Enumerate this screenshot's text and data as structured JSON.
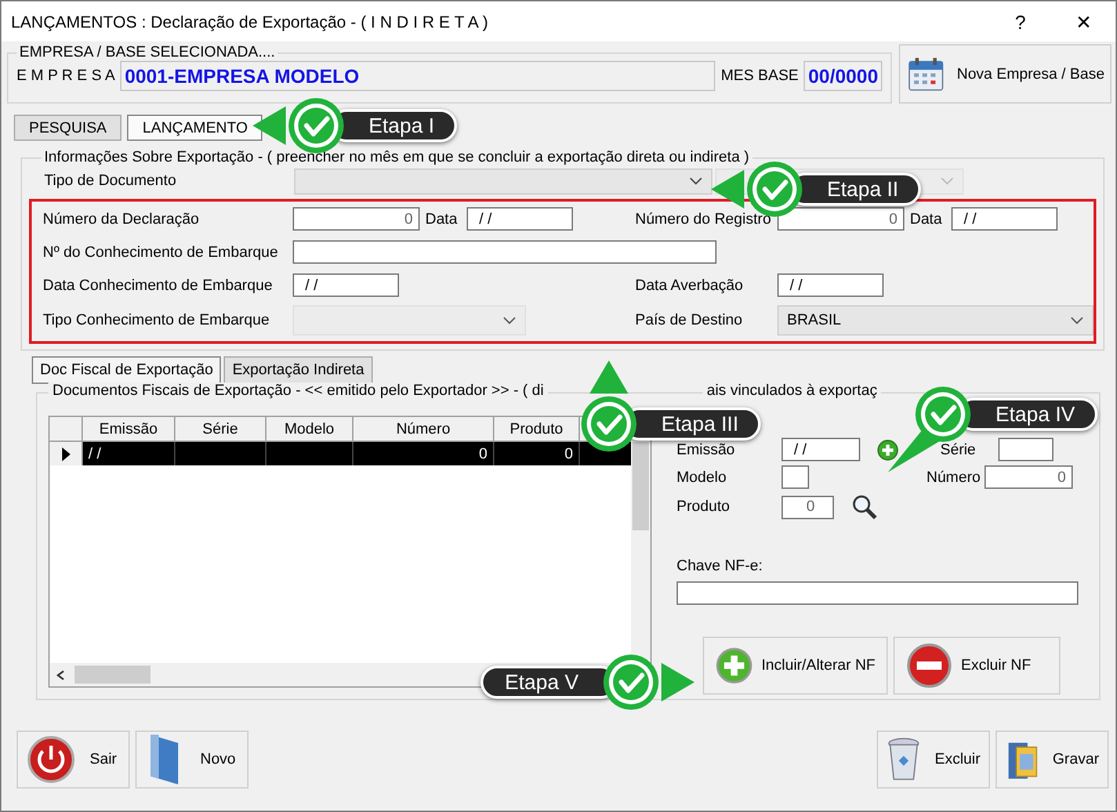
{
  "window": {
    "title": "LANÇAMENTOS : Declaração de Exportação - ( I N D I R E T A )",
    "buttons": [
      "?",
      "✕"
    ]
  },
  "empresa": {
    "legend": "EMPRESA / BASE SELECIONADA....",
    "label": "E M P R E S A",
    "value": "0001-EMPRESA MODELO",
    "mes_label": "MES BASE",
    "mes_value": "00/0000",
    "button": "Nova Empresa / Base"
  },
  "tabs": [
    {
      "label": "PESQUISA",
      "selected": false
    },
    {
      "label": "LANÇAMENTO",
      "selected": true
    }
  ],
  "info": {
    "legend": "Informações Sobre Exportação - ( preencher no mês em que se concluir a exportação direta ou indireta )",
    "tipo_label": "Tipo de Documento",
    "tipo_disabled": false,
    "extra_disabled": true,
    "fields": [
      {
        "label": "Número da Declaração",
        "value": "0",
        "kind": "number"
      },
      {
        "label": "Data",
        "value": "/ /",
        "kind": "date"
      },
      {
        "label": "Número do Registro",
        "value": "0",
        "kind": "number"
      },
      {
        "label": "Data",
        "value": "/ /",
        "kind": "date"
      },
      {
        "label": "Nº do Conhecimento de Embarque",
        "kind": "text"
      },
      {
        "label": "Data Conhecimento de Embarque",
        "value": "/ /",
        "kind": "date"
      },
      {
        "label": "Data Averbação",
        "value": "/ /",
        "kind": "date"
      },
      {
        "label": "Tipo Conhecimento de Embarque",
        "kind": "select",
        "disabled": true
      },
      {
        "label": "País de Destino",
        "value": "BRASIL",
        "kind": "select",
        "disabled": false
      }
    ]
  },
  "subtabs": [
    {
      "label": "Doc Fiscal de Exportação",
      "selected": true
    },
    {
      "label": "Exportação Indireta",
      "selected": false
    }
  ],
  "docs": {
    "legend_parts": [
      "Documentos Fiscais de Exportação - << emitido pelo Exportador >> - ( di",
      "ais vinculados à exportaç"
    ],
    "columns": [
      "Emissão",
      "Série",
      "Modelo",
      "Número",
      "Produto"
    ],
    "rows": [
      {
        "cells": [
          "/ /",
          "",
          "",
          "0",
          "0"
        ],
        "selected": true
      }
    ],
    "form": {
      "emissao_label": "Emissão",
      "emissao": "/ /",
      "serie_label": "Série",
      "modelo_label": "Modelo",
      "numero_label": "Número",
      "numero": "0",
      "produto_label": "Produto",
      "produto": "0",
      "chave_label": "Chave NF-e:"
    },
    "buttons": [
      {
        "label": "Incluir/Alterar NF",
        "kind": "add"
      },
      {
        "label": "Excluir NF",
        "kind": "remove"
      }
    ]
  },
  "footer_buttons": [
    {
      "label": "Sair",
      "kind": "power"
    },
    {
      "label": "Novo",
      "kind": "new"
    },
    {
      "label": "Excluir",
      "kind": "trash"
    },
    {
      "label": "Gravar",
      "kind": "save"
    }
  ],
  "callouts": [
    {
      "label": "Etapa I"
    },
    {
      "label": "Etapa II"
    },
    {
      "label": "Etapa III"
    },
    {
      "label": "Etapa IV"
    },
    {
      "label": "Etapa V"
    }
  ]
}
